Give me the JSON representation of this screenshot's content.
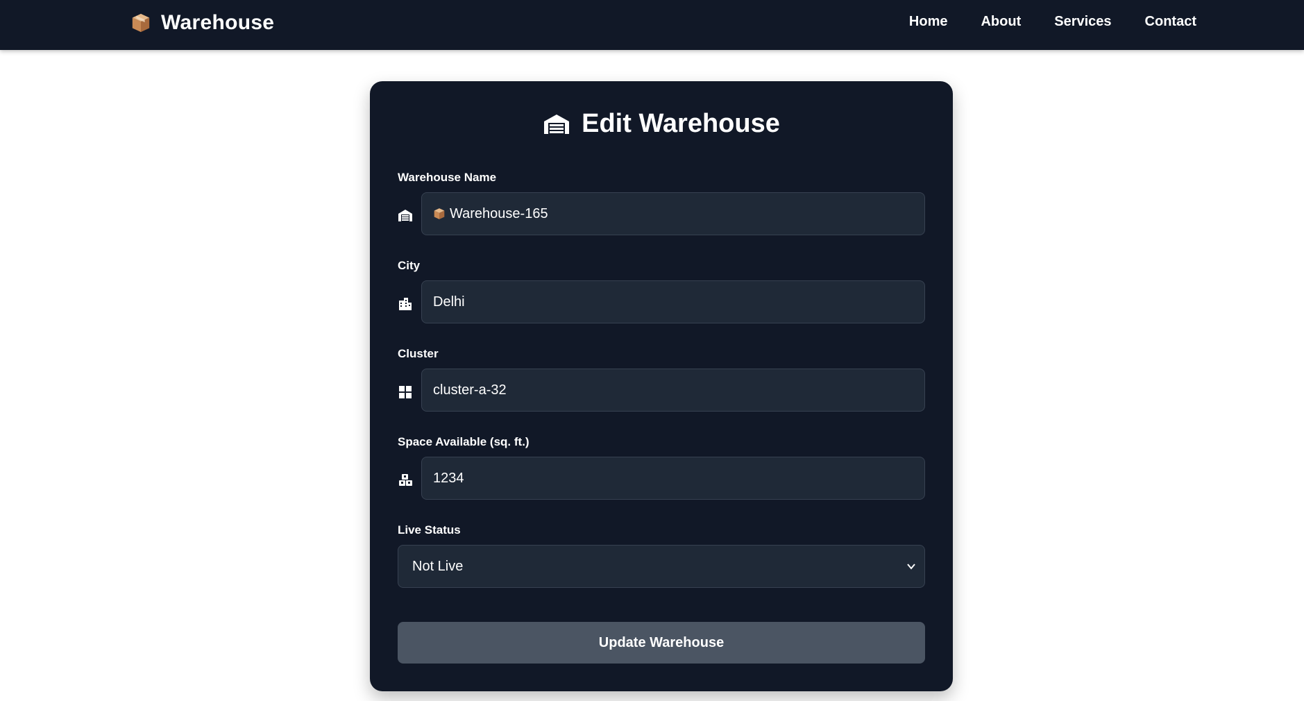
{
  "brand": {
    "name": "Warehouse",
    "icon": "package-box-icon"
  },
  "nav": {
    "items": [
      {
        "label": "Home"
      },
      {
        "label": "About"
      },
      {
        "label": "Services"
      },
      {
        "label": "Contact"
      }
    ]
  },
  "form": {
    "title": "Edit Warehouse",
    "title_icon": "warehouse-icon",
    "fields": {
      "name": {
        "label": "Warehouse Name",
        "value": "Warehouse-165",
        "icon": "warehouse-icon",
        "value_icon": "package-box-icon"
      },
      "city": {
        "label": "City",
        "value": "Delhi",
        "icon": "city-icon"
      },
      "cluster": {
        "label": "Cluster",
        "value": "cluster-a-32",
        "icon": "grid-icon"
      },
      "space": {
        "label": "Space Available (sq. ft.)",
        "value": "1234",
        "icon": "boxes-icon"
      },
      "status": {
        "label": "Live Status",
        "value": "Not Live",
        "options_visible": [
          "Not Live"
        ]
      }
    },
    "submit_label": "Update Warehouse"
  },
  "colors": {
    "navbar_bg": "#111827",
    "card_bg": "#111827",
    "input_bg": "#1f2937",
    "button_bg": "#4b5563",
    "text": "#ffffff"
  }
}
